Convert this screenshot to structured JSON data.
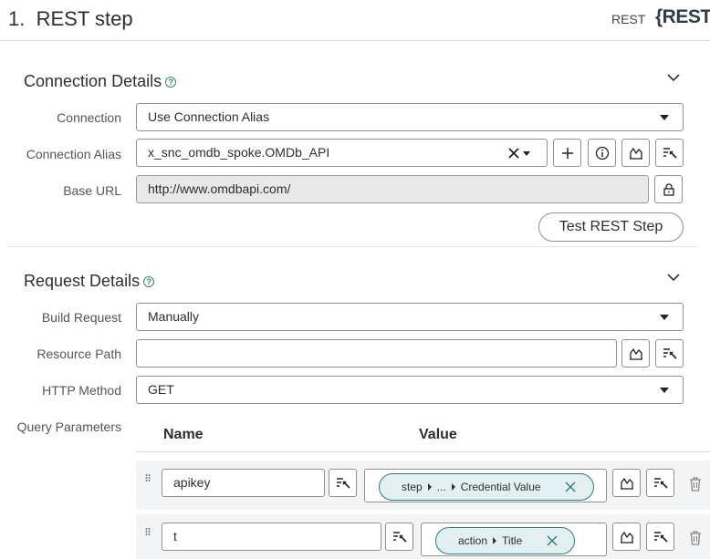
{
  "header": {
    "step_number": "1.",
    "step_title": "REST step",
    "step_type": "REST",
    "logo_text": "{REST}"
  },
  "connection": {
    "title": "Connection Details",
    "help": "?",
    "connection_label": "Connection",
    "connection_value": "Use Connection Alias",
    "alias_label": "Connection Alias",
    "alias_value": "x_snc_omdb_spoke.OMDb_API",
    "base_url_label": "Base URL",
    "base_url_value": "http://www.omdbapi.com/",
    "test_button": "Test REST Step"
  },
  "request": {
    "title": "Request Details",
    "help": "?",
    "build_label": "Build Request",
    "build_value": "Manually",
    "resource_label": "Resource Path",
    "resource_value": "",
    "method_label": "HTTP Method",
    "method_value": "GET",
    "query_label": "Query Parameters",
    "col_name": "Name",
    "col_value": "Value",
    "params": [
      {
        "name": "apikey",
        "pill_parts": [
          "step",
          "...",
          "Credential Value"
        ]
      },
      {
        "name": "t",
        "pill_parts": [
          "action",
          "Title"
        ]
      }
    ]
  },
  "icons": {
    "help": "help-icon",
    "collapse": "chevron-down-icon",
    "clear": "close-icon",
    "add": "plus-icon",
    "info": "info-icon",
    "script": "script-icon",
    "data_pill": "data-pill-picker-icon",
    "lock": "lock-icon",
    "drag": "drag-handle-icon",
    "delete": "trash-icon"
  },
  "colors": {
    "pill_border": "#2c7a7b",
    "pill_fill": "#e3f0f1",
    "help": "#2e8b57"
  }
}
